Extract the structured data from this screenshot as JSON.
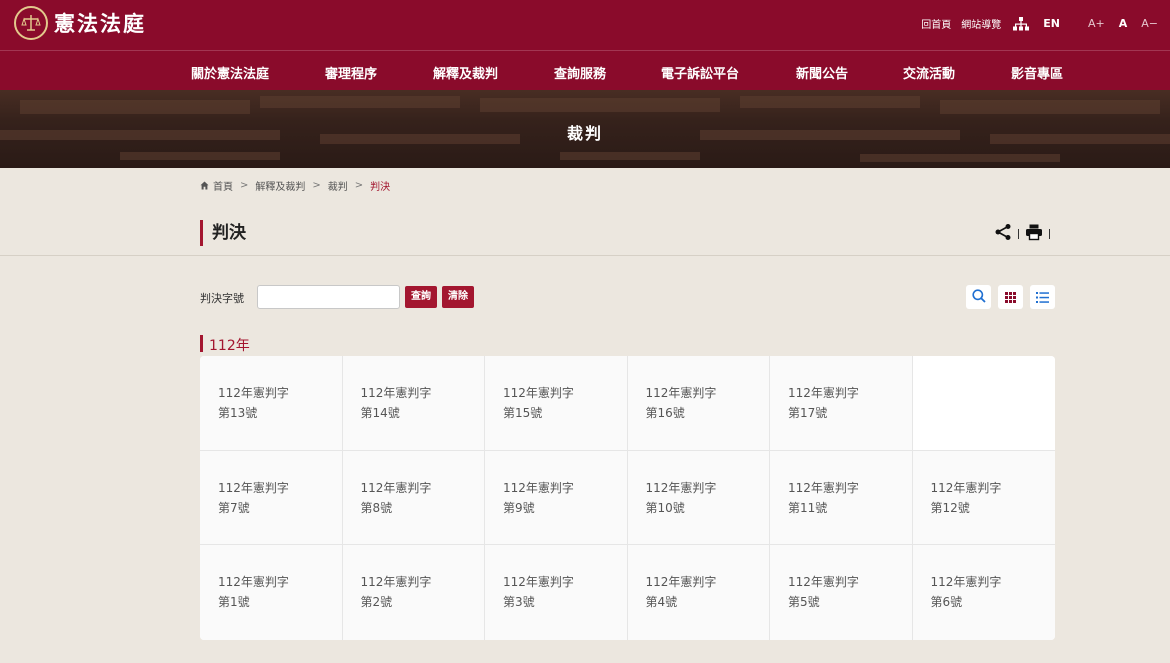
{
  "header": {
    "logo_text": "憲法法庭",
    "links": [
      "回首頁",
      "網站導覽"
    ],
    "lang": "EN",
    "font_sizes": [
      "A+",
      "A",
      "A−"
    ]
  },
  "nav": [
    "關於憲法法庭",
    "審理程序",
    "解釋及裁判",
    "查詢服務",
    "電子訴訟平台",
    "新聞公告",
    "交流活動",
    "影音專區"
  ],
  "banner": {
    "title": "裁判"
  },
  "breadcrumb": [
    "首頁",
    "解釋及裁判",
    "裁判",
    "判決"
  ],
  "breadcrumb_sep": ">",
  "page_title": "判決",
  "search": {
    "label": "判決字號",
    "value": "",
    "placeholder": "",
    "query_btn": "查詢",
    "clear_btn": "清除"
  },
  "year_heading": "112年",
  "rulings": [
    {
      "line1": "112年憲判字",
      "line2": "第13號"
    },
    {
      "line1": "112年憲判字",
      "line2": "第14號"
    },
    {
      "line1": "112年憲判字",
      "line2": "第15號"
    },
    {
      "line1": "112年憲判字",
      "line2": "第16號"
    },
    {
      "line1": "112年憲判字",
      "line2": "第17號"
    },
    {
      "line1": "",
      "line2": ""
    },
    {
      "line1": "112年憲判字",
      "line2": "第7號"
    },
    {
      "line1": "112年憲判字",
      "line2": "第8號"
    },
    {
      "line1": "112年憲判字",
      "line2": "第9號"
    },
    {
      "line1": "112年憲判字",
      "line2": "第10號"
    },
    {
      "line1": "112年憲判字",
      "line2": "第11號"
    },
    {
      "line1": "112年憲判字",
      "line2": "第12號"
    },
    {
      "line1": "112年憲判字",
      "line2": "第1號"
    },
    {
      "line1": "112年憲判字",
      "line2": "第2號"
    },
    {
      "line1": "112年憲判字",
      "line2": "第3號"
    },
    {
      "line1": "112年憲判字",
      "line2": "第4號"
    },
    {
      "line1": "112年憲判字",
      "line2": "第5號"
    },
    {
      "line1": "112年憲判字",
      "line2": "第6號"
    }
  ],
  "icons": {
    "logo": "court-emblem-icon",
    "sitemap": "sitemap-icon",
    "home": "home-icon",
    "share": "share-icon",
    "print": "print-icon",
    "search": "search-icon",
    "grid_view": "grid-view-icon",
    "list_view": "list-view-icon"
  },
  "colors": {
    "brand": "#8a0b2b",
    "accent": "#a3162f",
    "background": "#ece7df",
    "view_icon_blue": "#1f6fd1"
  }
}
